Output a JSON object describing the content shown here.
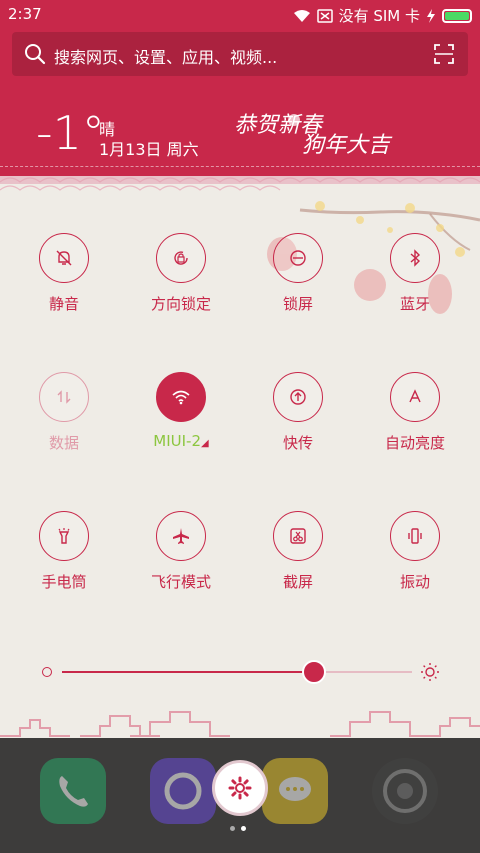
{
  "status": {
    "time": "2:37",
    "no_sim_label": "没有 SIM 卡",
    "battery_color": "#4bd964"
  },
  "search": {
    "placeholder": "搜索网页、设置、应用、视频..."
  },
  "weather": {
    "temperature": "-1°",
    "condition": "晴",
    "date": "1月13日 周六"
  },
  "greeting": "恭贺新春 狗年大吉",
  "accent_color": "#c8284a",
  "toggles": [
    {
      "label": "静音",
      "icon": "bell-off-icon",
      "state": "off"
    },
    {
      "label": "方向锁定",
      "icon": "rotation-lock-icon",
      "state": "off"
    },
    {
      "label": "锁屏",
      "icon": "lock-icon",
      "state": "off"
    },
    {
      "label": "蓝牙",
      "icon": "bluetooth-icon",
      "state": "off"
    },
    {
      "label": "数据",
      "icon": "data-arrows-icon",
      "state": "disabled"
    },
    {
      "label": "MIUI-2",
      "icon": "wifi-icon",
      "state": "on"
    },
    {
      "label": "快传",
      "icon": "share-icon",
      "state": "off"
    },
    {
      "label": "自动亮度",
      "icon": "auto-brightness-icon",
      "state": "off"
    },
    {
      "label": "手电筒",
      "icon": "flashlight-icon",
      "state": "off"
    },
    {
      "label": "飞行模式",
      "icon": "airplane-icon",
      "state": "off"
    },
    {
      "label": "截屏",
      "icon": "screenshot-icon",
      "state": "off"
    },
    {
      "label": "振动",
      "icon": "vibrate-icon",
      "state": "off"
    }
  ],
  "brightness": {
    "level": 0.72
  },
  "dock": {
    "page_count": 2,
    "active_page": 2
  }
}
